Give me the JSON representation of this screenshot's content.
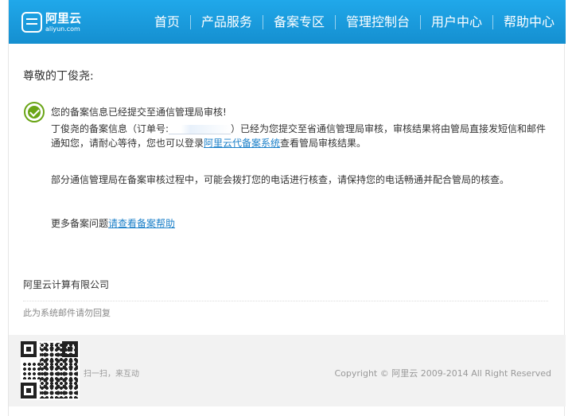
{
  "header": {
    "logo_name": "阿里云",
    "logo_domain": "aliyun.com",
    "nav": [
      "首页",
      "产品服务",
      "备案专区",
      "管理控制台",
      "用户中心",
      "帮助中心"
    ]
  },
  "email": {
    "greeting": "尊敬的丁俊尧:",
    "submitted": "您的备案信息已经提交至通信管理局审核!",
    "para1_a": "丁俊尧的备案信息（订单号:",
    "para1_b": "）已经为您提交至省通信管理局审核，审核结果将由管局直接发短信和邮件通知您，请耐心等待，您也可以登录",
    "para1_link": "阿里云代备案系统",
    "para1_c": "查看管局审核结果。",
    "para2": "部分通信管理局在备案审核过程中，可能会拨打您的电话进行核查，请保持您的电话畅通并配合管局的核查。",
    "para3_a": "更多备案问题",
    "para3_link": "请查看备案帮助",
    "company": "阿里云计算有限公司",
    "noreply": "此为系统邮件请勿回复"
  },
  "footer": {
    "scan": "扫一扫，来互动",
    "copyright": "Copyright © 阿里云 2009-2014 All Right Reserved"
  },
  "colors": {
    "header_blue": "#1a9fe0",
    "link_blue": "#1a7fc8",
    "check_green": "#6aa516"
  },
  "icons": [
    "aliyun-logo-icon",
    "check-circle-icon",
    "qr-code-icon"
  ]
}
